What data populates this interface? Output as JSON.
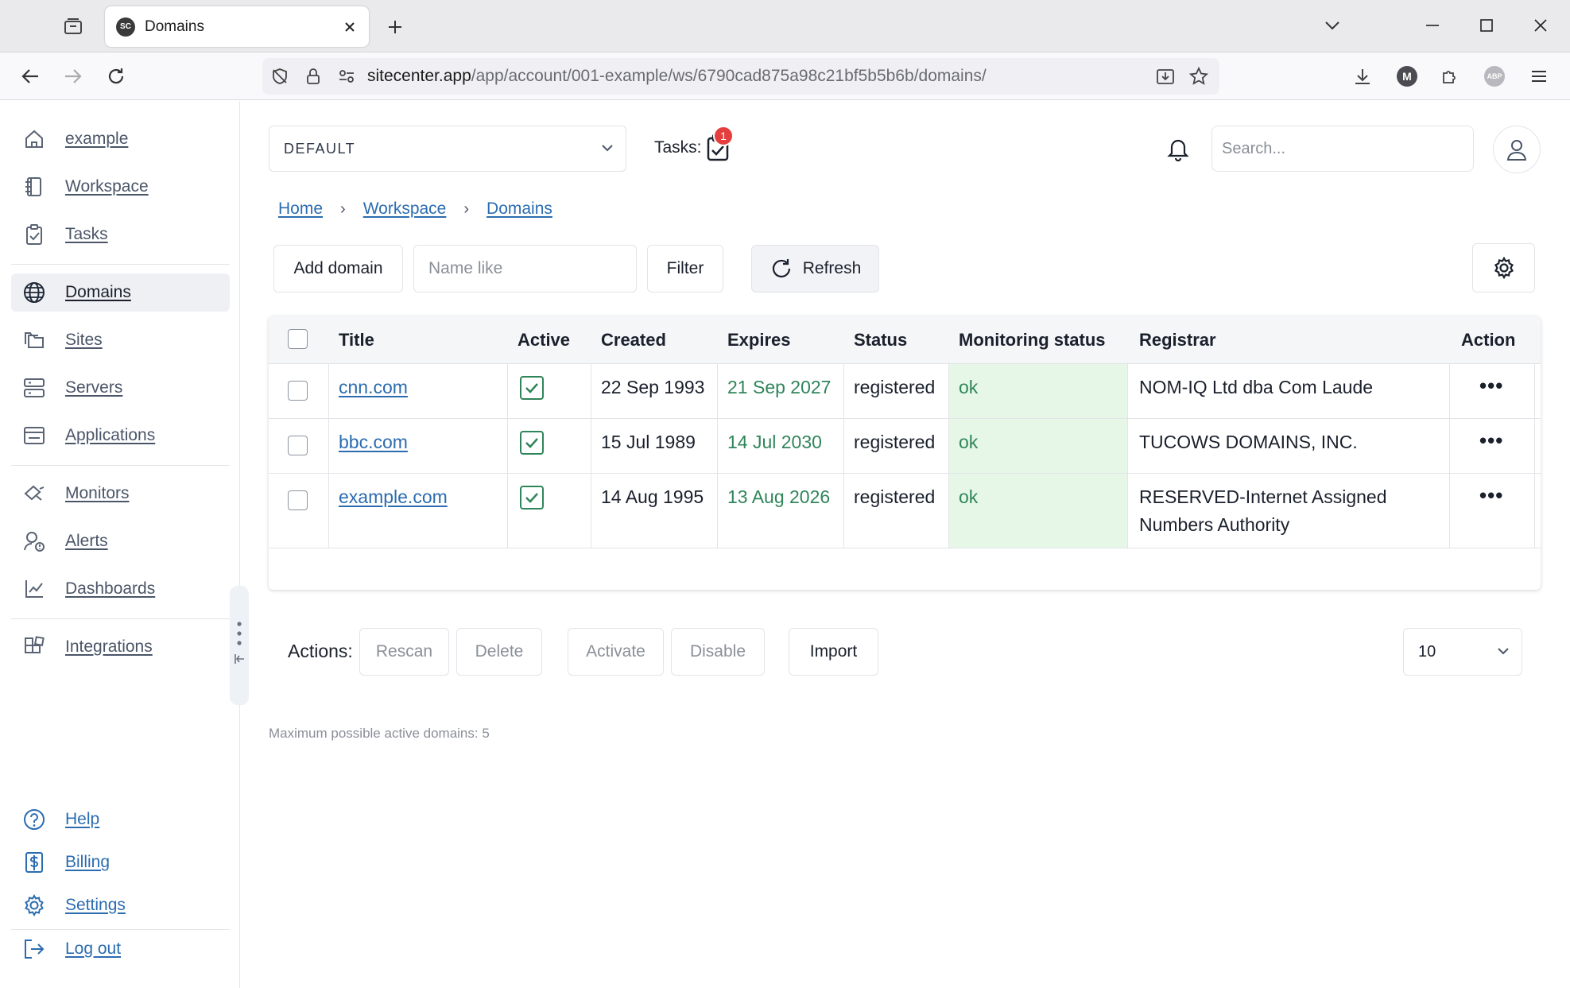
{
  "browser": {
    "tab_title": "Domains",
    "favicon_text": "SC",
    "url_host": "sitecenter.app",
    "url_path": "/app/account/001-example/ws/6790cad875a98c21bf5b5b6b/domains/",
    "profile_initial": "M",
    "abp_label": "ABP"
  },
  "sidebar": {
    "items": [
      {
        "label": "example",
        "icon": "home-icon"
      },
      {
        "label": "Workspace",
        "icon": "notebook-icon"
      },
      {
        "label": "Tasks",
        "icon": "clipboard-check-icon"
      },
      {
        "label": "Domains",
        "icon": "globe-icon",
        "active": true
      },
      {
        "label": "Sites",
        "icon": "folders-icon"
      },
      {
        "label": "Servers",
        "icon": "server-icon"
      },
      {
        "label": "Applications",
        "icon": "window-icon"
      },
      {
        "label": "Monitors",
        "icon": "monitor-icon"
      },
      {
        "label": "Alerts",
        "icon": "alert-user-icon"
      },
      {
        "label": "Dashboards",
        "icon": "line-chart-icon"
      },
      {
        "label": "Integrations",
        "icon": "puzzle-grid-icon"
      }
    ],
    "bottom": [
      {
        "label": "Help",
        "icon": "help-circle-icon"
      },
      {
        "label": "Billing",
        "icon": "dollar-file-icon"
      },
      {
        "label": "Settings",
        "icon": "gear-icon"
      },
      {
        "label": "Log out",
        "icon": "logout-icon"
      }
    ]
  },
  "header": {
    "workspace_select": "DEFAULT",
    "tasks_label": "Tasks:",
    "tasks_badge": "1",
    "search_placeholder": "Search..."
  },
  "breadcrumb": [
    "Home",
    "Workspace",
    "Domains"
  ],
  "toolbar": {
    "add_domain": "Add domain",
    "name_placeholder": "Name like",
    "filter": "Filter",
    "refresh": "Refresh"
  },
  "table": {
    "columns": [
      "Title",
      "Active",
      "Created",
      "Expires",
      "Status",
      "Monitoring status",
      "Registrar",
      "Action"
    ],
    "rows": [
      {
        "title": "cnn.com",
        "active": true,
        "created": "22 Sep 1993",
        "expires": "21 Sep 2027",
        "status": "registered",
        "monitoring": "ok",
        "registrar": [
          "NOM-IQ Ltd dba Com Laude"
        ]
      },
      {
        "title": "bbc.com",
        "active": true,
        "created": "15 Jul 1989",
        "expires": "14 Jul 2030",
        "status": "registered",
        "monitoring": "ok",
        "registrar": [
          "TUCOWS DOMAINS, INC."
        ]
      },
      {
        "title": "example.com",
        "active": true,
        "created": "14 Aug 1995",
        "expires": "13 Aug 2026",
        "status": "registered",
        "monitoring": "ok",
        "registrar": [
          "RESERVED-Internet Assigned",
          "Numbers Authority"
        ]
      }
    ],
    "action_glyph": "•••"
  },
  "actions": {
    "label": "Actions:",
    "rescan": "Rescan",
    "delete": "Delete",
    "activate": "Activate",
    "disable": "Disable",
    "import": "Import",
    "per_page": "10"
  },
  "footer_note": "Maximum possible active domains: 5",
  "colors": {
    "link": "#2b6cb0",
    "expires_green": "#2f855a",
    "monitor_bg": "#e6f7e8",
    "badge_red": "#e53e3e"
  }
}
